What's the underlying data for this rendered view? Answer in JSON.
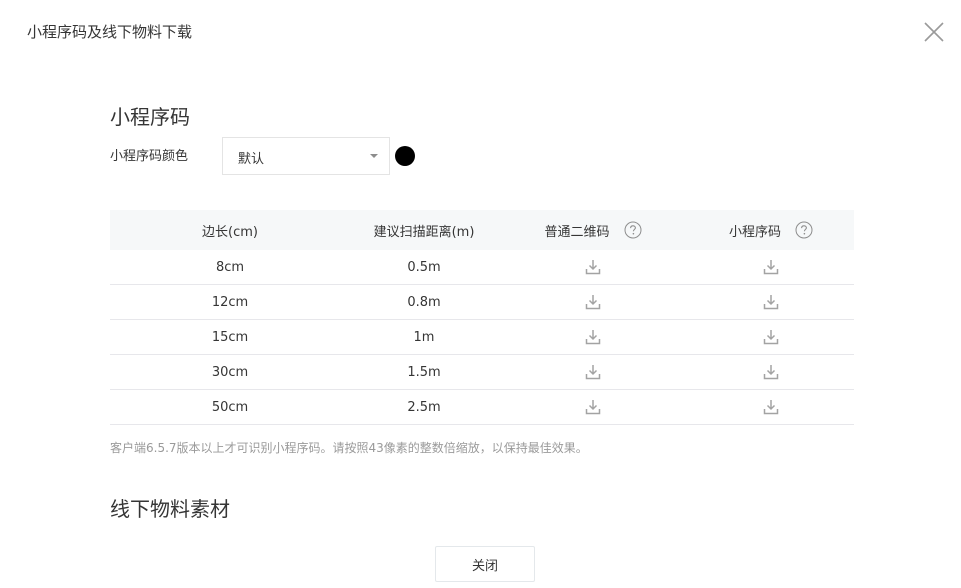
{
  "dialog": {
    "title": "小程序码及线下物料下载"
  },
  "qrcode_section": {
    "title": "小程序码",
    "color_label": "小程序码颜色",
    "color_select": {
      "value": "默认"
    },
    "color_swatch": "#000000"
  },
  "table": {
    "headers": {
      "side_length": "边长(cm)",
      "scan_distance": "建议扫描距离(m)",
      "normal_qr": "普通二维码",
      "mini_code": "小程序码"
    },
    "rows": [
      {
        "side": "8cm",
        "distance": "0.5m"
      },
      {
        "side": "12cm",
        "distance": "0.8m"
      },
      {
        "side": "15cm",
        "distance": "1m"
      },
      {
        "side": "30cm",
        "distance": "1.5m"
      },
      {
        "side": "50cm",
        "distance": "2.5m"
      }
    ],
    "icons": {
      "help": "question-circle-icon",
      "download": "download-icon"
    }
  },
  "note": "客户端6.5.7版本以上才可识别小程序码。请按照43像素的整数倍缩放，以保持最佳效果。",
  "offline_section": {
    "title": "线下物料素材"
  },
  "footer": {
    "close_label": "关闭"
  }
}
